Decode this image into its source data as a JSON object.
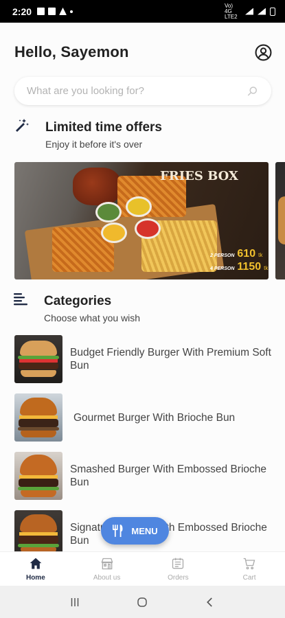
{
  "status_bar": {
    "time": "2:20",
    "network": "Vo) 4G LTE2"
  },
  "header": {
    "greeting": "Hello, Sayemon"
  },
  "search": {
    "placeholder": "What are you looking for?"
  },
  "offers": {
    "title": "Limited time offers",
    "subtitle": "Enjoy it before it's over",
    "banner": {
      "title": "FRIES BOX",
      "prices": [
        {
          "label": "2 PERSON",
          "price": "610",
          "unit": "tk"
        },
        {
          "label": "4 PERSON",
          "price": "1150",
          "unit": "tk"
        }
      ]
    }
  },
  "categories": {
    "title": "Categories",
    "subtitle": "Choose what you wish",
    "items": [
      {
        "name": "Budget Friendly Burger With Premium Soft Bun"
      },
      {
        "name": "Gourmet Burger With Brioche Bun"
      },
      {
        "name": "Smashed Burger With Embossed Brioche Bun"
      },
      {
        "name": "Signature Burger With Embossed Brioche Bun"
      }
    ]
  },
  "menu_button": {
    "label": "MENU"
  },
  "bottom_nav": [
    {
      "label": "Home",
      "active": true
    },
    {
      "label": "About us",
      "active": false
    },
    {
      "label": "Orders",
      "active": false
    },
    {
      "label": "Cart",
      "active": false
    }
  ],
  "colors": {
    "accent": "#4f86e0",
    "nav_active": "#1f2a44",
    "nav_inactive": "#aaaaaa"
  }
}
